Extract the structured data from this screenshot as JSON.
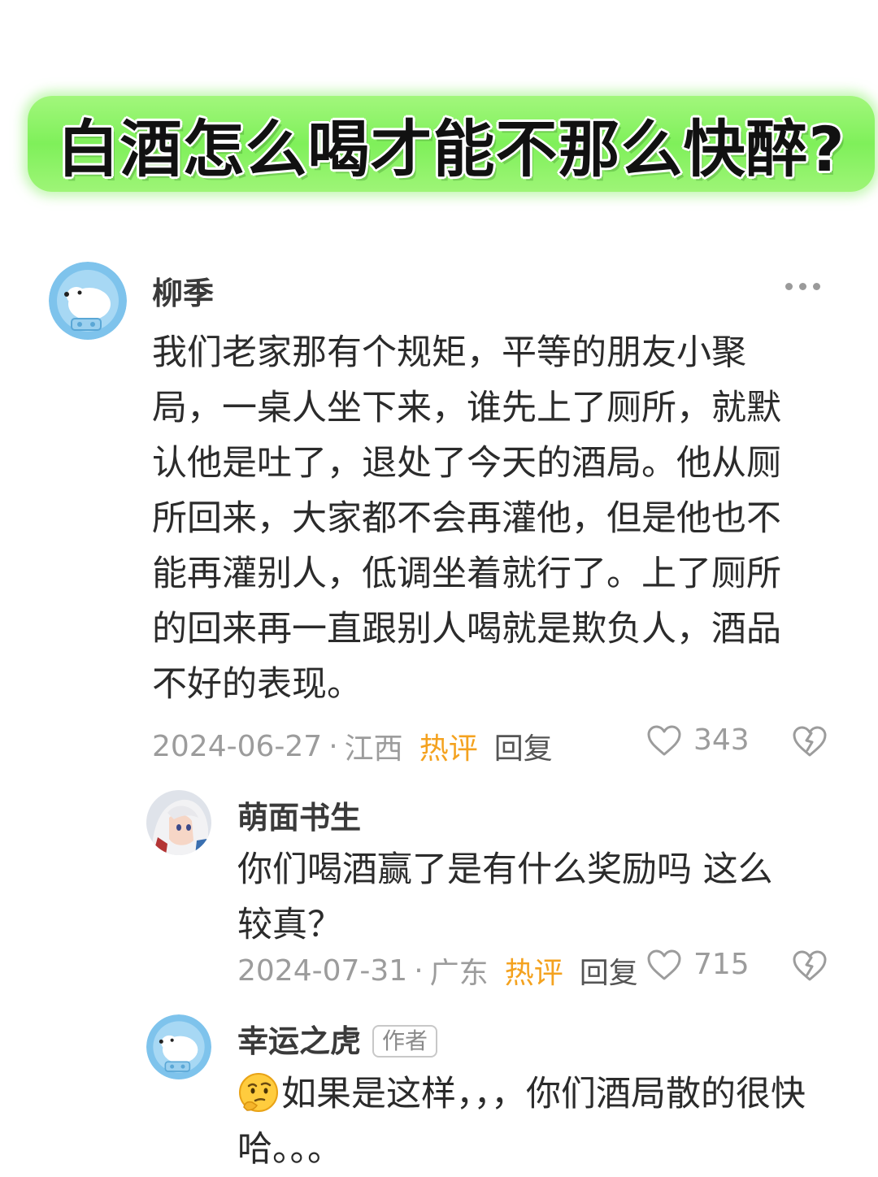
{
  "title": "白酒怎么喝才能不那么快醉?",
  "comments": [
    {
      "username": "柳季",
      "text": "我们老家那有个规矩，平等的朋友小聚局，一桌人坐下来，谁先上了厕所，就默认他是吐了，退处了今天的酒局。他从厕所回来，大家都不会再灌他，但是他也不能再灌别人，低调坐着就行了。上了厕所的回来再一直跟别人喝就是欺负人，酒品不好的表现。",
      "date": "2024-06-27",
      "separator": "·",
      "location": "江西",
      "hot_label": "热评",
      "reply_label": "回复",
      "likes": "343"
    },
    {
      "username": "萌面书生",
      "text": "你们喝酒赢了是有什么奖励吗 这么较真？",
      "date": "2024-07-31",
      "separator": "·",
      "location": "广东",
      "hot_label": "热评",
      "reply_label": "回复",
      "likes": "715"
    },
    {
      "username": "幸运之虎",
      "badge": "作者",
      "emoji": "thinking-face-icon",
      "text": "如果是这样，，，你们酒局散的很快哈。。。"
    }
  ],
  "colors": {
    "banner_green": "#7ff05a",
    "hot_orange": "#f4a21f",
    "meta_gray": "#9c9c9c"
  }
}
